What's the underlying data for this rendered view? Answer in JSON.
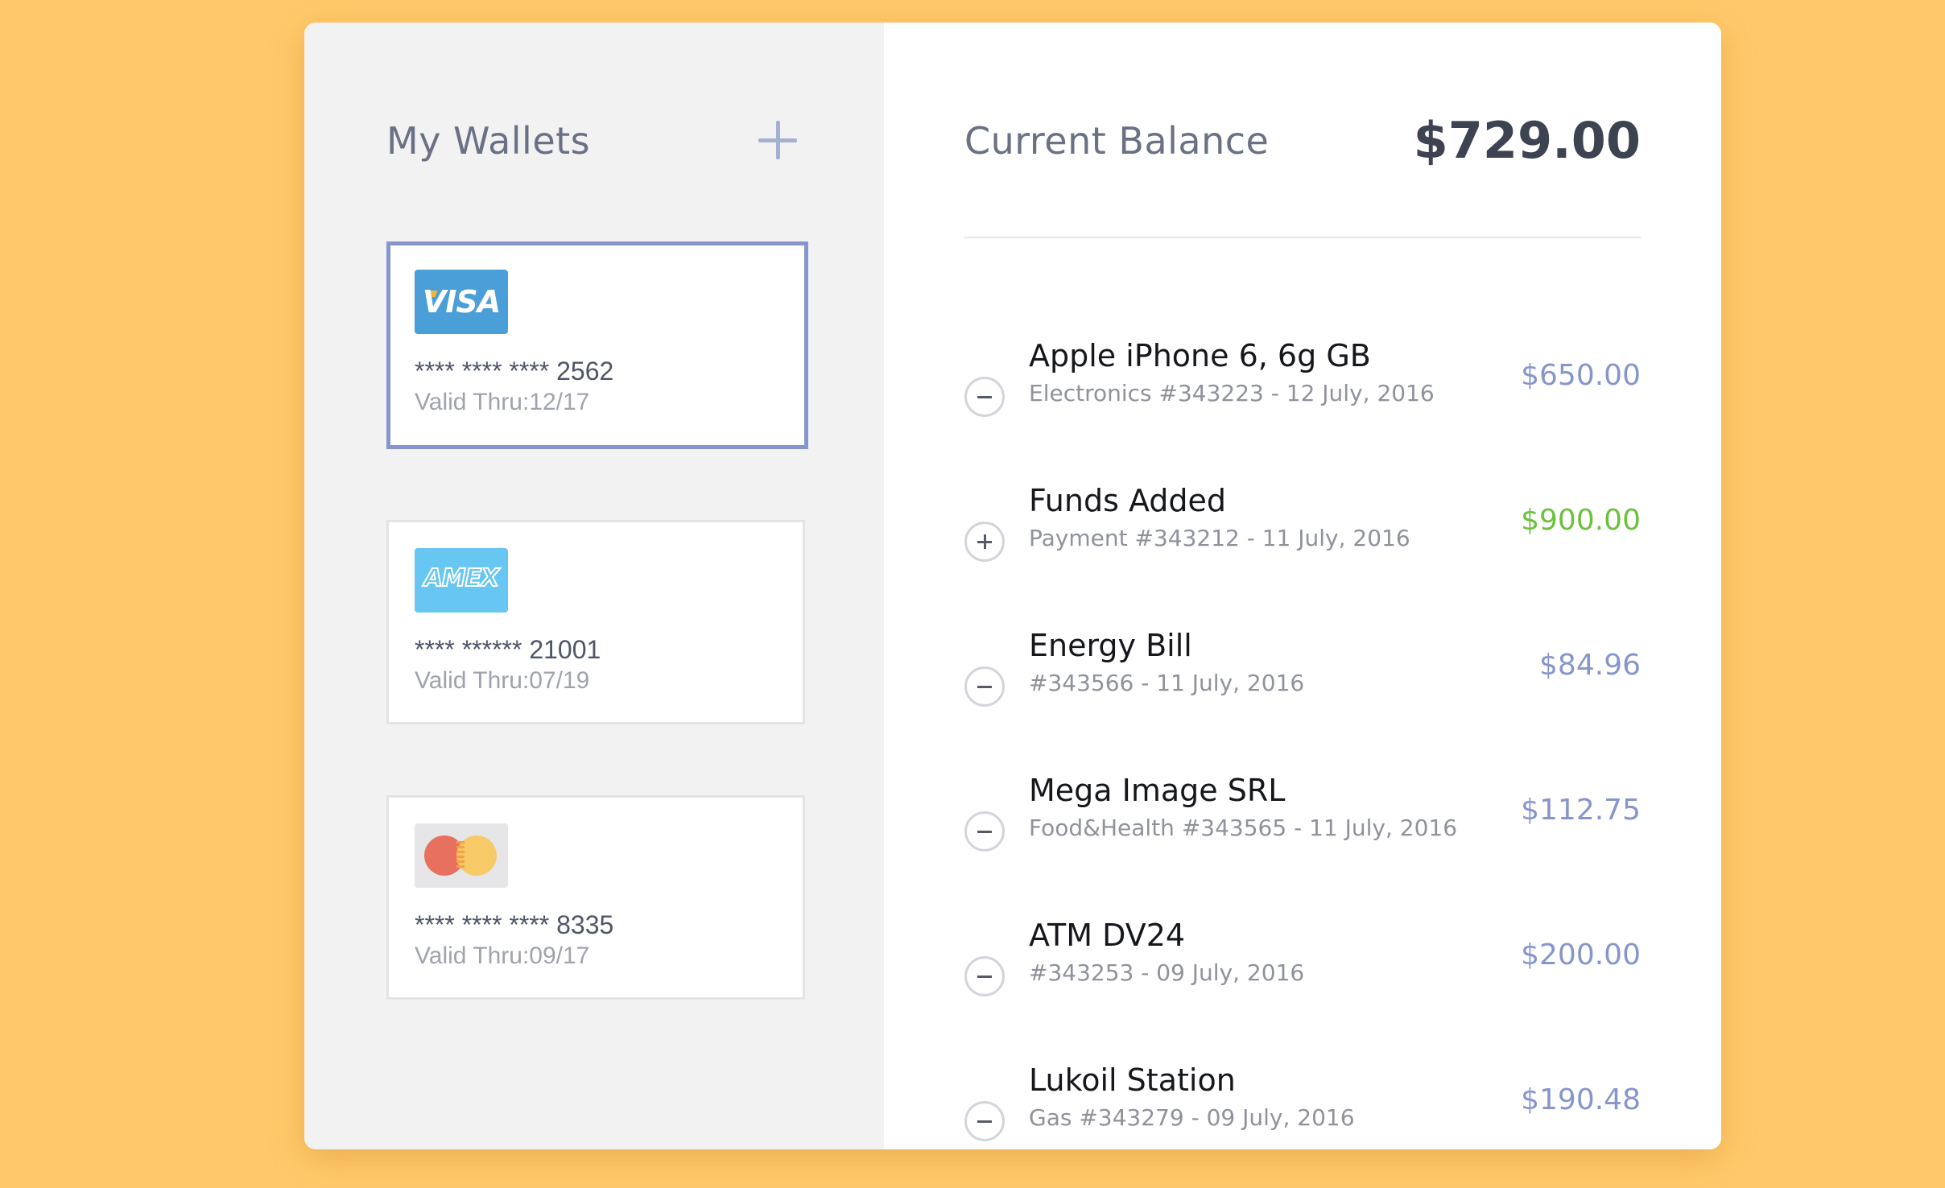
{
  "wallets": {
    "title": "My Wallets",
    "add_icon": "plus-icon",
    "cards": [
      {
        "brand": "VISA",
        "icon": "visa-logo",
        "number": "**** **** **** 2562",
        "valid": "Valid Thru:12/17",
        "selected": true
      },
      {
        "brand": "AMEX",
        "icon": "amex-logo",
        "number": "**** ****** 21001",
        "valid": "Valid Thru:07/19",
        "selected": false
      },
      {
        "brand": "Mastercard",
        "icon": "mastercard-logo",
        "number": "**** **** **** 8335",
        "valid": "Valid Thru:09/17",
        "selected": false
      }
    ]
  },
  "balance": {
    "label": "Current Balance",
    "value": "$729.00"
  },
  "transactions": [
    {
      "title": "Apple iPhone 6, 6g GB",
      "meta": "Electronics #343223 - 12 July, 2016",
      "amount": "$650.00",
      "type": "debit",
      "icon": "minus-icon"
    },
    {
      "title": "Funds Added",
      "meta": "Payment #343212 - 11 July, 2016",
      "amount": "$900.00",
      "type": "credit",
      "icon": "plus-icon"
    },
    {
      "title": "Energy Bill",
      "meta": "#343566 - 11 July, 2016",
      "amount": "$84.96",
      "type": "debit",
      "icon": "minus-icon"
    },
    {
      "title": "Mega Image SRL",
      "meta": "Food&Health #343565 - 11 July, 2016",
      "amount": "$112.75",
      "type": "debit",
      "icon": "minus-icon"
    },
    {
      "title": "ATM DV24",
      "meta": "#343253 - 09 July, 2016",
      "amount": "$200.00",
      "type": "debit",
      "icon": "minus-icon"
    },
    {
      "title": "Lukoil Station",
      "meta": "Gas #343279 - 09 July, 2016",
      "amount": "$190.48",
      "type": "debit",
      "icon": "minus-icon"
    }
  ],
  "colors": {
    "background": "#FFC96B",
    "accent": "#8696CC",
    "positive": "#6CC13D"
  }
}
